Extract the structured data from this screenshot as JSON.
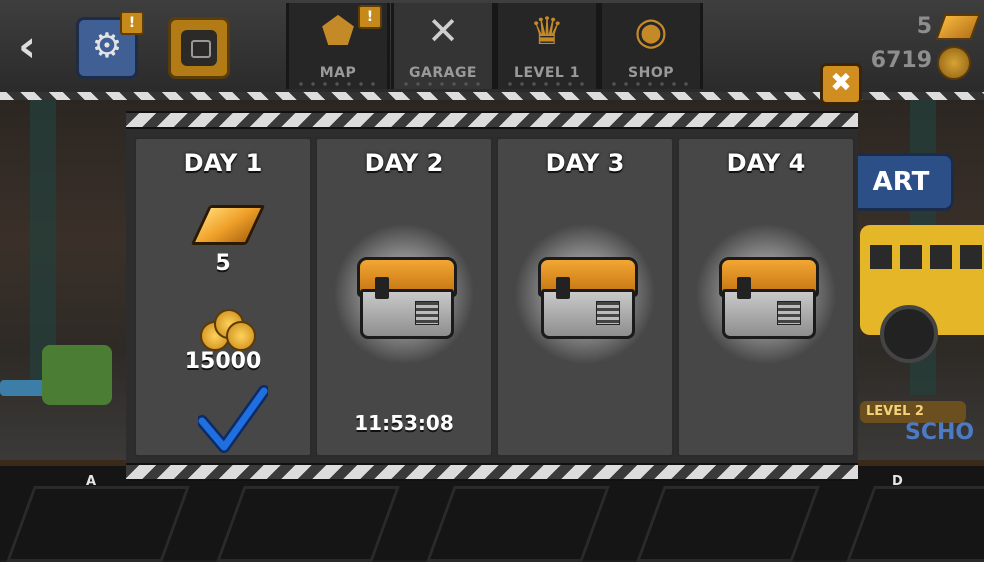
{
  "topbar": {
    "tabs": [
      {
        "label": "MAP",
        "icon": "map-marker-icon",
        "alert": "!"
      },
      {
        "label": "GARAGE",
        "icon": "wrench-screwdriver-icon"
      },
      {
        "label": "LEVEL 1",
        "icon": "trophy-icon"
      },
      {
        "label": "SHOP",
        "icon": "coin-stack-icon"
      }
    ],
    "settings_alert": "!",
    "gold": "5",
    "coins": "6719"
  },
  "background": {
    "start_label": "ART",
    "level_badge": "LEVEL 2",
    "sign_text": "SCHO"
  },
  "dialog": {
    "close_symbol": "✖",
    "days": [
      {
        "title": "DAY 1",
        "gold": "5",
        "coins": "15000",
        "claimed": true
      },
      {
        "title": "DAY 2",
        "reward": "chest",
        "timer": "11:53:08"
      },
      {
        "title": "DAY 3",
        "reward": "chest"
      },
      {
        "title": "DAY 4",
        "reward": "chest"
      }
    ]
  },
  "corner_labels": {
    "left": "A",
    "right": "D"
  },
  "colors": {
    "accent": "#d08e20",
    "panel": "#474747",
    "check": "#1f6fe0",
    "settings_blue": "#3f5f95"
  }
}
